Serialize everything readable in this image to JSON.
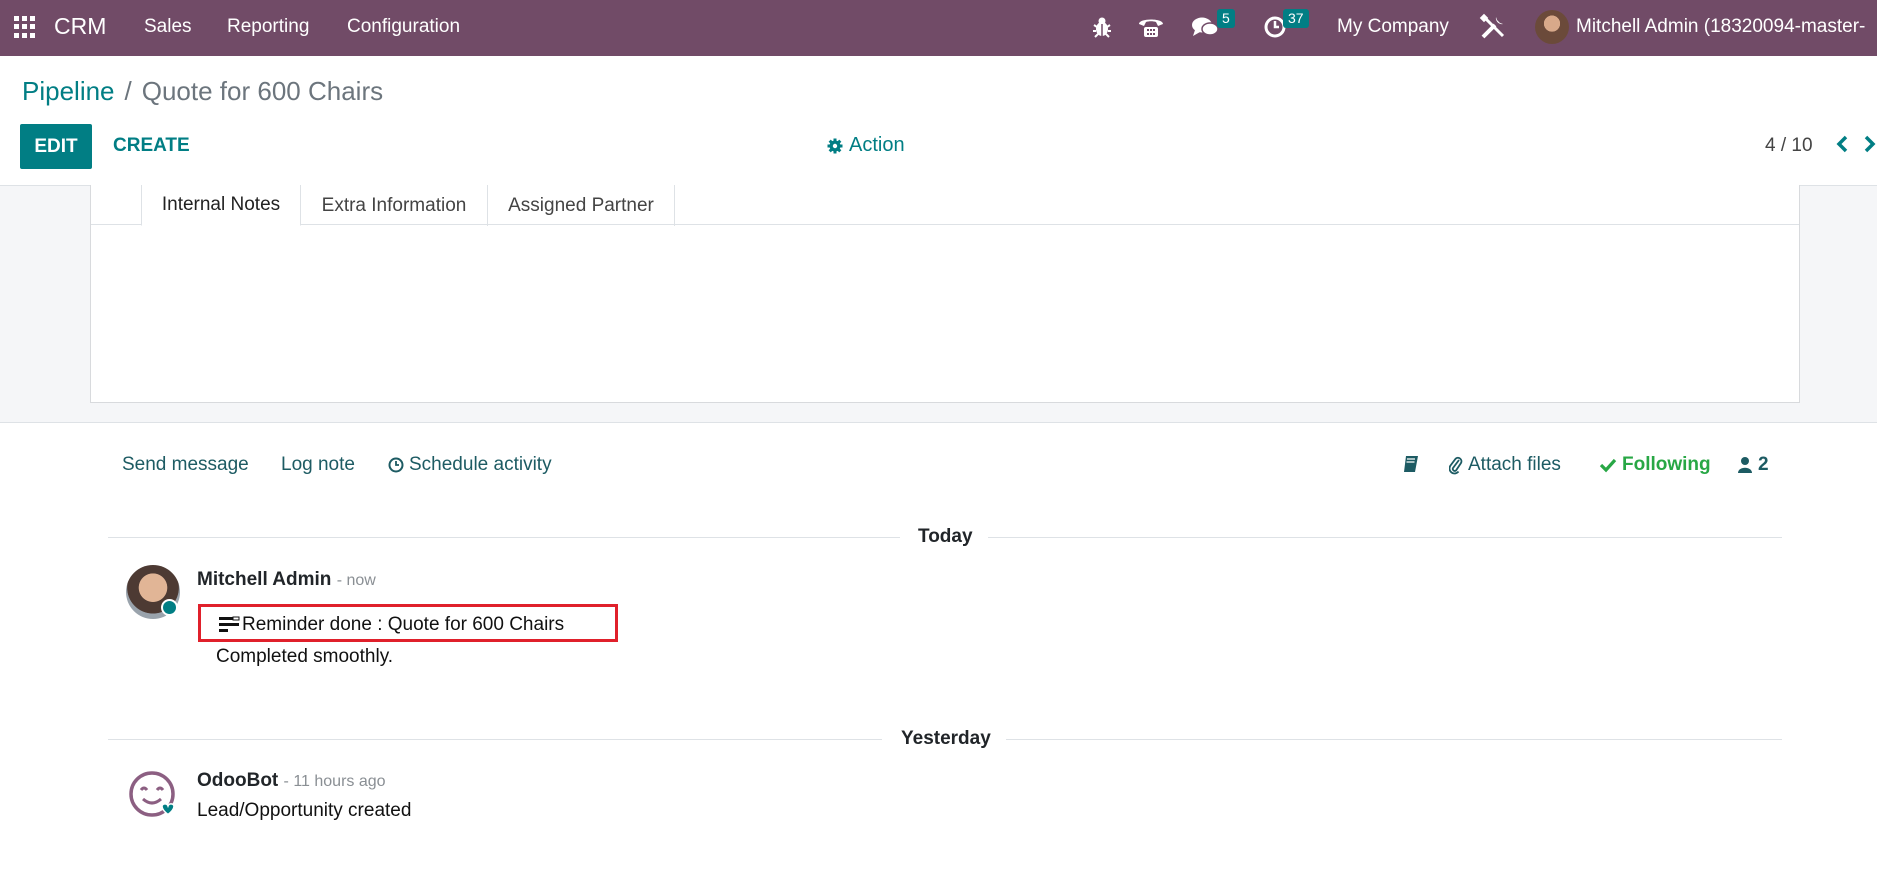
{
  "navbar": {
    "app_name": "CRM",
    "menu": [
      "Sales",
      "Reporting",
      "Configuration"
    ],
    "messages_badge": "5",
    "activities_badge": "37",
    "company": "My Company",
    "user": "Mitchell Admin (18320094-master-"
  },
  "control_panel": {
    "breadcrumb_parent": "Pipeline",
    "breadcrumb_separator": "/",
    "breadcrumb_current": "Quote for 600 Chairs",
    "edit_label": "EDIT",
    "create_label": "CREATE",
    "action_label": "Action",
    "pager": "4 / 10"
  },
  "form": {
    "tabs": [
      "Internal Notes",
      "Extra Information",
      "Assigned Partner"
    ]
  },
  "chatter": {
    "send_message": "Send message",
    "log_note": "Log note",
    "schedule_activity": "Schedule activity",
    "attach_files": "Attach files",
    "following": "Following",
    "followers_count": "2",
    "groups": [
      {
        "day": "Today",
        "messages": [
          {
            "author": "Mitchell Admin",
            "date": "- now",
            "title": "Reminder done : Quote for 600 Chairs",
            "body": "Completed smoothly."
          }
        ]
      },
      {
        "day": "Yesterday",
        "messages": [
          {
            "author": "OdooBot",
            "date": "- 11 hours ago",
            "body": "Lead/Opportunity created"
          }
        ]
      }
    ]
  },
  "colors": {
    "navbar": "#714b67",
    "primary": "#017e84",
    "following": "#28a745",
    "highlight": "#e0202b"
  }
}
